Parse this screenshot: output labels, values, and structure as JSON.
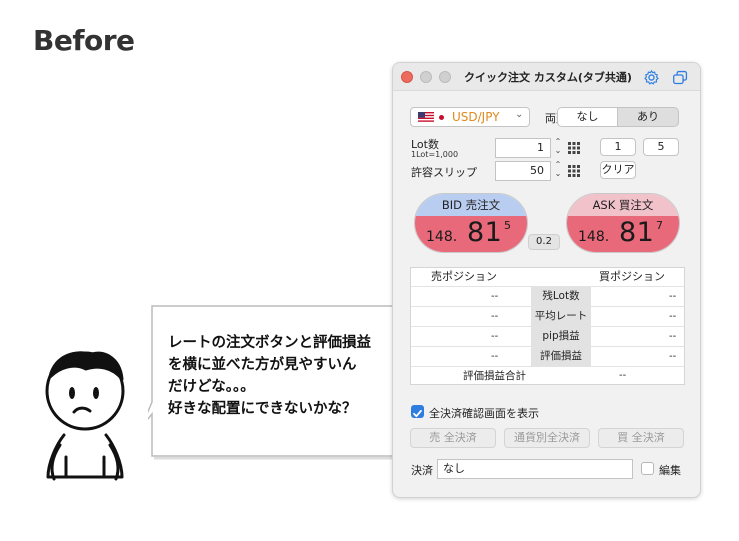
{
  "heading": "Before",
  "speech_bubble": {
    "lines": [
      "レートの注文ボタンと評価損益",
      "を横に並べた方が見やすいん",
      "だけどな。。。",
      "好きな配置にできないかな？"
    ]
  },
  "window": {
    "title": "クイック注文 カスタム(タブ共通)",
    "icons": [
      "settings-gear-icon",
      "window-overlap-icon"
    ],
    "currency_pair": {
      "selected": "USD/JPY",
      "flag": "us-flag-icon"
    },
    "both_sides": {
      "label": "両建",
      "options": [
        "なし",
        "あり"
      ],
      "selected": "なし"
    },
    "lot": {
      "label": "Lot数",
      "sublabel": "1Lot=1,000",
      "value": "1",
      "preset_buttons": [
        "1",
        "5"
      ]
    },
    "slippage": {
      "label": "許容スリップ",
      "value": "50",
      "clear_button": "クリア"
    },
    "bid": {
      "label": "BID 売注文",
      "price_small": "148.",
      "price_big": "81",
      "price_sup": "5"
    },
    "ask": {
      "label": "ASK 買注文",
      "price_small": "148.",
      "price_big": "81",
      "price_sup": "7"
    },
    "spread": "0.2",
    "positions": {
      "sell_header": "売ポジション",
      "buy_header": "買ポジション",
      "rows": [
        {
          "label": "残Lot数",
          "sell": "--",
          "buy": "--"
        },
        {
          "label": "平均レート",
          "sell": "--",
          "buy": "--"
        },
        {
          "label": "pip損益",
          "sell": "--",
          "buy": "--"
        },
        {
          "label": "評価損益",
          "sell": "--",
          "buy": "--"
        }
      ],
      "total_label": "評価損益合計",
      "total_value": "--"
    },
    "confirm_checkbox": {
      "label": "全決済確認画面を表示",
      "checked": true
    },
    "bulk_buttons": [
      "売 全決済",
      "通貨別全決済",
      "買 全決済"
    ],
    "settlement": {
      "label": "決済",
      "value": "なし"
    },
    "edit_checkbox": {
      "label": "編集",
      "checked": false
    }
  },
  "colors": {
    "bid_header": "#b9cdf0",
    "ask_header": "#f2c2cb",
    "price_body": "#e8697a",
    "currency_text": "#e08a1e",
    "checkbox_on": "#2f7de1"
  }
}
